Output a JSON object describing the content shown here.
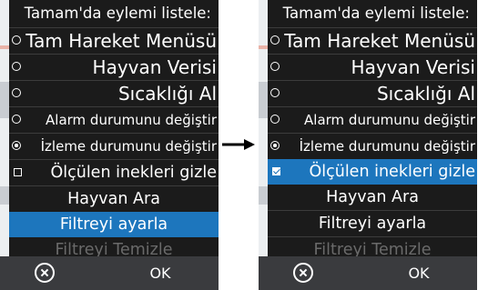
{
  "before": {
    "title": "Tamam'da eylemi listele:",
    "items": [
      {
        "label": "Tam Hareket Menüsü",
        "control": "radio",
        "checked": false
      },
      {
        "label": "Hayvan Verisi",
        "control": "radio",
        "checked": false
      },
      {
        "label": "Sıcaklığı Al",
        "control": "radio",
        "checked": false
      },
      {
        "label": "Alarm durumunu değiştir",
        "control": "radio",
        "checked": false
      },
      {
        "label": "İzleme durumunu değiştir",
        "control": "radio",
        "checked": true
      },
      {
        "label": "Ölçülen inekleri gizle",
        "control": "checkbox",
        "checked": false
      },
      {
        "label": "Hayvan Ara",
        "control": "none"
      },
      {
        "label": "Filtreyi ayarla",
        "control": "none",
        "selected": true
      },
      {
        "label": "Filtreyi Temizle",
        "control": "none",
        "disabled": true
      }
    ],
    "ok_label": "OK"
  },
  "after": {
    "title": "Tamam'da eylemi listele:",
    "items": [
      {
        "label": "Tam Hareket Menüsü",
        "control": "radio",
        "checked": false
      },
      {
        "label": "Hayvan Verisi",
        "control": "radio",
        "checked": false
      },
      {
        "label": "Sıcaklığı Al",
        "control": "radio",
        "checked": false
      },
      {
        "label": "Alarm durumunu değiştir",
        "control": "radio",
        "checked": false
      },
      {
        "label": "İzleme durumunu değiştir",
        "control": "radio",
        "checked": true
      },
      {
        "label": "Ölçülen inekleri gizle",
        "control": "checkbox",
        "checked": true,
        "selected": true
      },
      {
        "label": "Hayvan Ara",
        "control": "none"
      },
      {
        "label": "Filtreyi ayarla",
        "control": "none"
      },
      {
        "label": "Filtreyi Temizle",
        "control": "none",
        "disabled": true
      }
    ],
    "ok_label": "OK"
  },
  "colors": {
    "menu_bg": "#1b1b1b",
    "highlight": "#1d76bd",
    "bottom_bar": "#3a3b3e",
    "disabled_text": "#6a6a6a"
  },
  "icons": {
    "cancel": "cancel-circle-x-icon",
    "transition": "arrow-right-icon"
  }
}
